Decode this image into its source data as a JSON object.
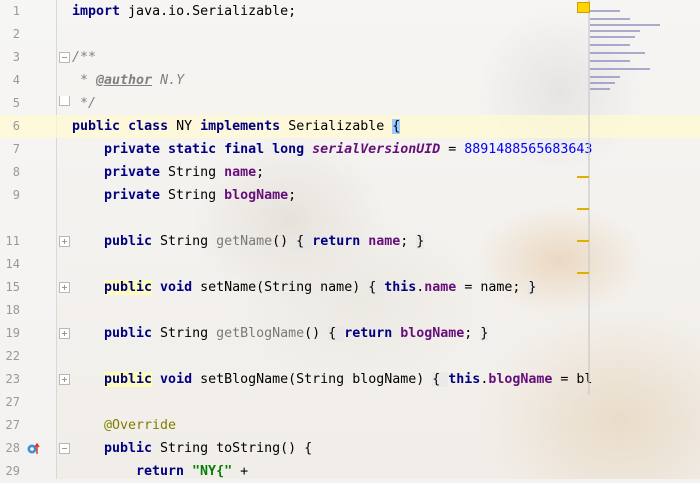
{
  "editor": {
    "lines": [
      {
        "n": "1"
      },
      {
        "n": "2"
      },
      {
        "n": "3"
      },
      {
        "n": "4"
      },
      {
        "n": "5"
      },
      {
        "n": "6"
      },
      {
        "n": "7"
      },
      {
        "n": "8"
      },
      {
        "n": "9"
      },
      {
        "n": "11"
      },
      {
        "n": "14"
      },
      {
        "n": "15"
      },
      {
        "n": "18"
      },
      {
        "n": "19"
      },
      {
        "n": "22"
      },
      {
        "n": "23"
      },
      {
        "n": "27"
      },
      {
        "n": "28"
      },
      {
        "n": "29"
      }
    ],
    "code": {
      "l1_kw": "import",
      "l1_rest": " java.io.Serializable;",
      "l3": "/**",
      "l4_star": " * ",
      "l4_tag": "@author",
      "l4_rest": " N.Y",
      "l5": " */",
      "l6_kw1": "public",
      "l6_kw2": "class",
      "l6_name": " NY ",
      "l6_kw3": "implements",
      "l6_iface": " Serializable ",
      "l6_brace": "{",
      "l7_kw": "private static final long ",
      "l7_field": "serialVersionUID",
      "l7_eq": " = ",
      "l7_num": "8891488565683643",
      "l8_kw": "private ",
      "l8_type": "String ",
      "l8_field": "name",
      "l8_end": ";",
      "l9_kw": "private ",
      "l9_type": "String ",
      "l9_field": "blogName",
      "l9_end": ";",
      "l11_kw": "public ",
      "l11_type": "String ",
      "l11_m": "getName",
      "l11_p": "() ",
      "l11_b1": "{ ",
      "l11_ret": "return ",
      "l11_field": "name",
      "l11_semi": "; ",
      "l11_b2": "}",
      "l15_kw": "public",
      "l15_void": " void ",
      "l15_sig": "setName(String name) ",
      "l15_b1": "{ ",
      "l15_this": "this",
      "l15_dot": ".",
      "l15_field": "name",
      "l15_rest": " = name; ",
      "l15_b2": "}",
      "l19_kw": "public ",
      "l19_type": "String ",
      "l19_m": "getBlogName",
      "l19_p": "() ",
      "l19_b1": "{ ",
      "l19_ret": "return ",
      "l19_field": "blogName",
      "l19_semi": "; ",
      "l19_b2": "}",
      "l23_kw": "public",
      "l23_void": " void ",
      "l23_sig": "setBlogName(String blogName) ",
      "l23_b1": "{ ",
      "l23_this": "this",
      "l23_dot": ".",
      "l23_field": "blogName",
      "l23_rest": " = bl",
      "l27_ann": "@Override",
      "l28_kw": "public ",
      "l28_rest": "String toString() {",
      "l29_ret": "return ",
      "l29_str": "\"NY{\"",
      "l29_rest": " +"
    }
  },
  "colors": {
    "keyword": "#000080",
    "field": "#660e7a",
    "number": "#0000ff",
    "comment": "#808080",
    "annotation": "#808000",
    "string": "#008000",
    "caret_line": "#fffad2"
  }
}
